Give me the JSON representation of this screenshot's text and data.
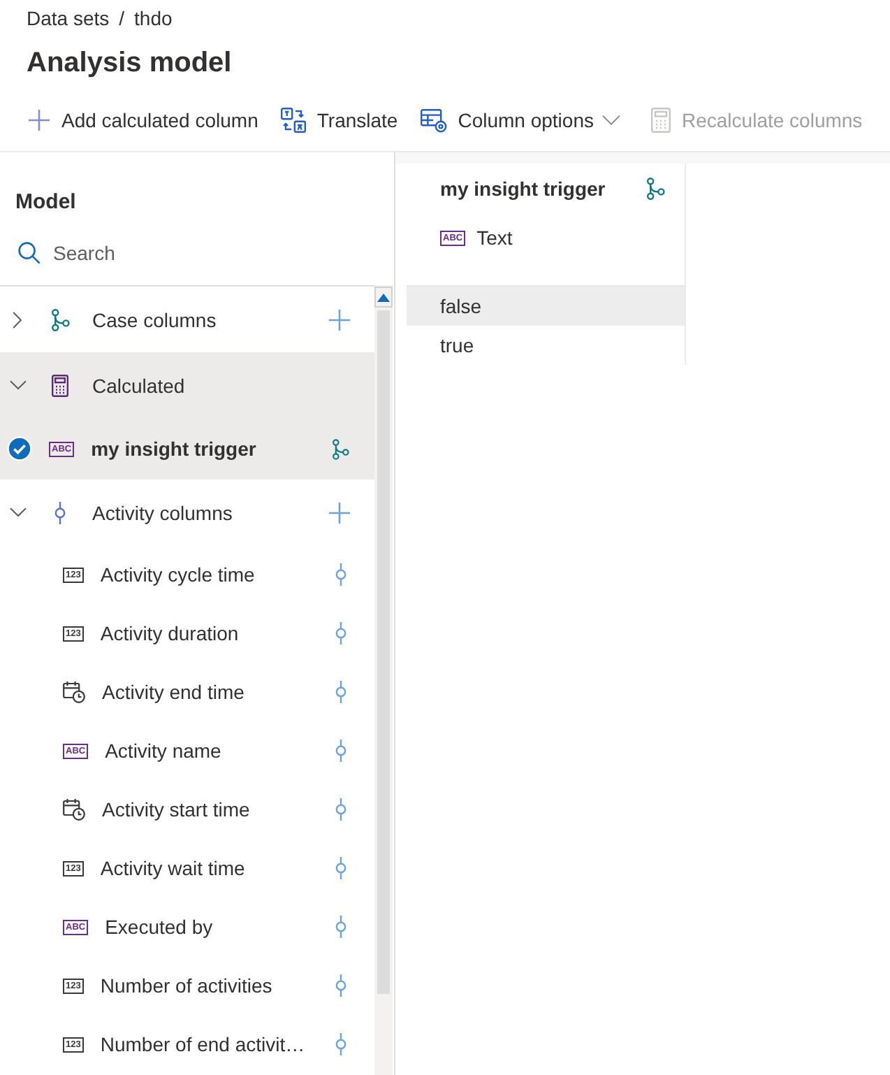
{
  "breadcrumb": {
    "items": [
      "Data sets",
      "thdo"
    ],
    "separator": "/"
  },
  "title": "Analysis model",
  "toolbar": [
    {
      "kind": "add",
      "label": "Add calculated column",
      "disabled": false,
      "dropdown": false
    },
    {
      "kind": "translate",
      "label": "Translate",
      "disabled": false,
      "dropdown": false
    },
    {
      "kind": "column_options",
      "label": "Column options",
      "disabled": false,
      "dropdown": true
    },
    {
      "kind": "calculator",
      "label": "Recalculate columns",
      "disabled": true,
      "dropdown": false
    }
  ],
  "model_panel": {
    "title": "Model",
    "search": {
      "placeholder": "Search"
    },
    "groups": [
      {
        "kind": "case",
        "label": "Case columns",
        "expanded": false,
        "highlighted": false,
        "add_button": true
      },
      {
        "kind": "calculated",
        "label": "Calculated",
        "expanded": true,
        "highlighted": true,
        "add_button": false,
        "children": [
          {
            "label": "my insight trigger",
            "kind": "text",
            "badge": "ABC",
            "case_level": true,
            "selected": true
          }
        ]
      },
      {
        "kind": "activity",
        "label": "Activity columns",
        "expanded": true,
        "highlighted": false,
        "add_button": true,
        "children": [
          {
            "label": "Activity cycle time",
            "kind": "number",
            "badge": "123",
            "case_level": false,
            "selected": false
          },
          {
            "label": "Activity duration",
            "kind": "number",
            "badge": "123",
            "case_level": false,
            "selected": false
          },
          {
            "label": "Activity end time",
            "kind": "datetime",
            "case_level": false,
            "selected": false
          },
          {
            "label": "Activity name",
            "kind": "text",
            "badge": "ABC",
            "case_level": false,
            "selected": false
          },
          {
            "label": "Activity start time",
            "kind": "datetime",
            "case_level": false,
            "selected": false
          },
          {
            "label": "Activity wait time",
            "kind": "number",
            "badge": "123",
            "case_level": false,
            "selected": false
          },
          {
            "label": "Executed by",
            "kind": "text",
            "badge": "ABC",
            "case_level": false,
            "selected": false
          },
          {
            "label": "Number of activities",
            "kind": "number",
            "badge": "123",
            "case_level": false,
            "selected": false
          },
          {
            "label": "Number of end activit…",
            "kind": "number",
            "badge": "123",
            "case_level": false,
            "selected": false
          }
        ]
      }
    ]
  },
  "column_detail": {
    "title": "my insight trigger",
    "case_level": true,
    "kind": "text",
    "badge": "ABC",
    "type_label": "Text",
    "values": [
      {
        "text": "false",
        "highlighted": true
      },
      {
        "text": "true",
        "highlighted": false
      }
    ]
  }
}
